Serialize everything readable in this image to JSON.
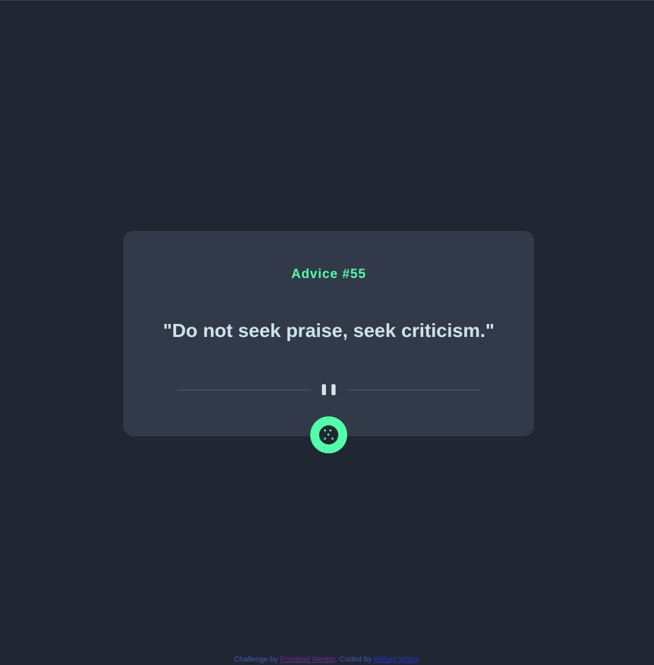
{
  "advice": {
    "id_label": "Advice #55",
    "text": "\"Do not seek praise, seek criticism.\""
  },
  "divider": {
    "icon": "pause-icon"
  },
  "dice_button": {
    "icon": "dice-icon"
  },
  "footer": {
    "challenge_prefix": "Challenge by ",
    "challenge_link": "Frontend Mentor",
    "coded_prefix": ". Coded by ",
    "author_link": "Kelsey Wong",
    "suffix": "."
  },
  "colors": {
    "background": "#202632",
    "card": "#323a49",
    "accent": "#53ffaa",
    "text": "#cee3e9",
    "divider": "#4f5d74"
  }
}
